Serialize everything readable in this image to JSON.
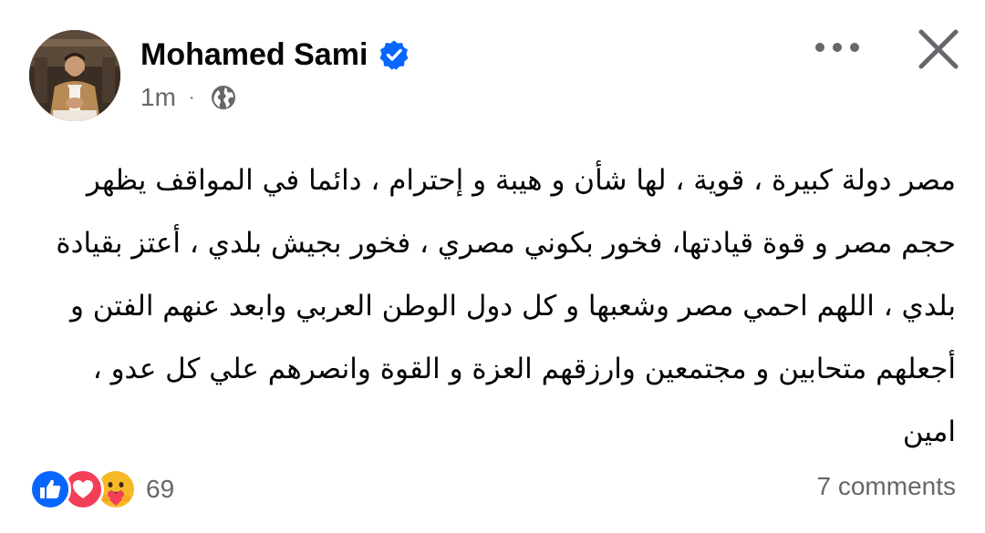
{
  "header": {
    "author_name": "Mohamed Sami",
    "timestamp": "1m",
    "separator": "·",
    "audience_icon": "globe-icon",
    "verified_icon": "verified-badge-icon",
    "more_icon": "more-options-icon",
    "close_icon": "close-icon"
  },
  "post": {
    "lines": [
      "مصر دولة كبيرة ، قوية ، لها شأن و هيبة و إحترام ، دائما في المواقف يظهر",
      "حجم مصر و قوة قيادتها، فخور بكوني مصري ، فخور بجيش بلدي ، أعتز بقيادة",
      "بلدي ، اللهم احمي مصر  وشعبها و كل دول الوطن العربي وابعد عنهم الفتن و",
      "أجعلهم متحابين و مجتمعين وارزقهم العزة و القوة وانصرهم علي كل عدو ،",
      "امين"
    ]
  },
  "footer": {
    "reaction_icons": [
      "like-icon",
      "love-icon",
      "care-icon"
    ],
    "reaction_count": "69",
    "comments": "7 comments"
  },
  "colors": {
    "brand_blue": "#0866ff",
    "love_red": "#f33e58",
    "care_yellow": "#f7b928",
    "secondary_text": "#65676b",
    "primary_text": "#050505"
  }
}
